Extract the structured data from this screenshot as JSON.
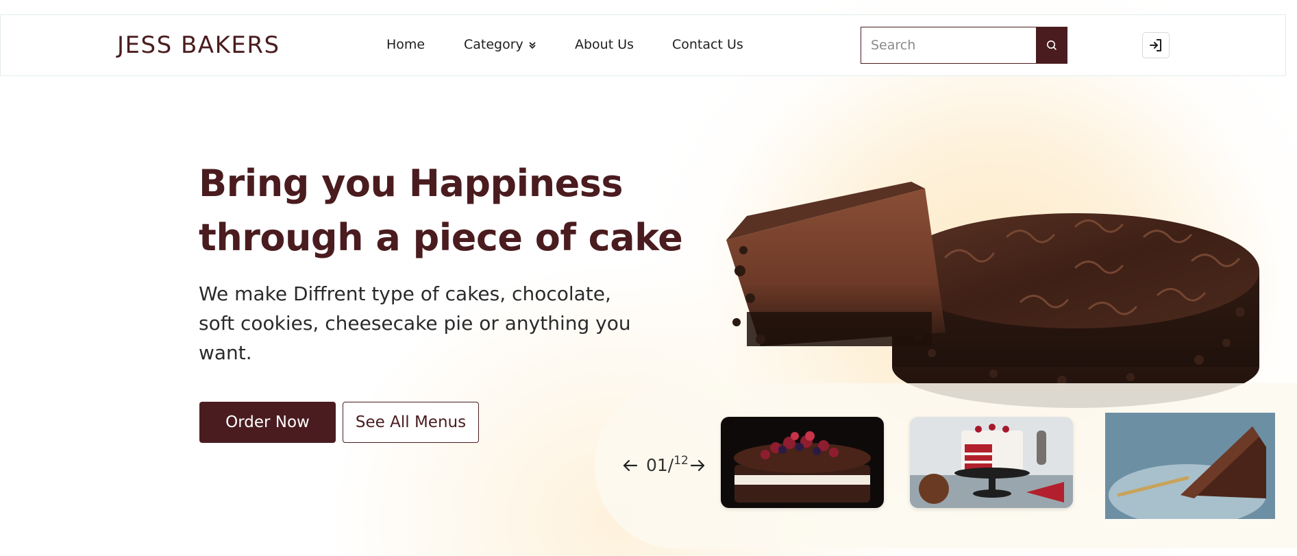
{
  "brand": {
    "name": "JESS BAKERS"
  },
  "nav": {
    "home": "Home",
    "category": "Category",
    "about": "About Us",
    "contact": "Contact Us"
  },
  "search": {
    "placeholder": "Search"
  },
  "hero": {
    "headline_line1": "Bring you Happiness",
    "headline_line2": "through a piece of cake",
    "subtext": "We make Diffrent type of cakes, chocolate, soft cookies, cheesecake pie or anything you want.",
    "order_button": "Order Now",
    "menus_button": "See All Menus"
  },
  "carousel": {
    "current": "01/",
    "total": "12",
    "thumbnails": [
      "berry-chocolate-cake",
      "red-velvet-cake",
      "chocolate-layer-slice"
    ]
  },
  "colors": {
    "brand": "#4a1c1f",
    "cream": "#fde9c4",
    "text": "#2a2a2a"
  },
  "icons": [
    "search-icon",
    "login-icon",
    "chevron-double-down-icon",
    "arrow-left-icon",
    "arrow-right-icon"
  ]
}
